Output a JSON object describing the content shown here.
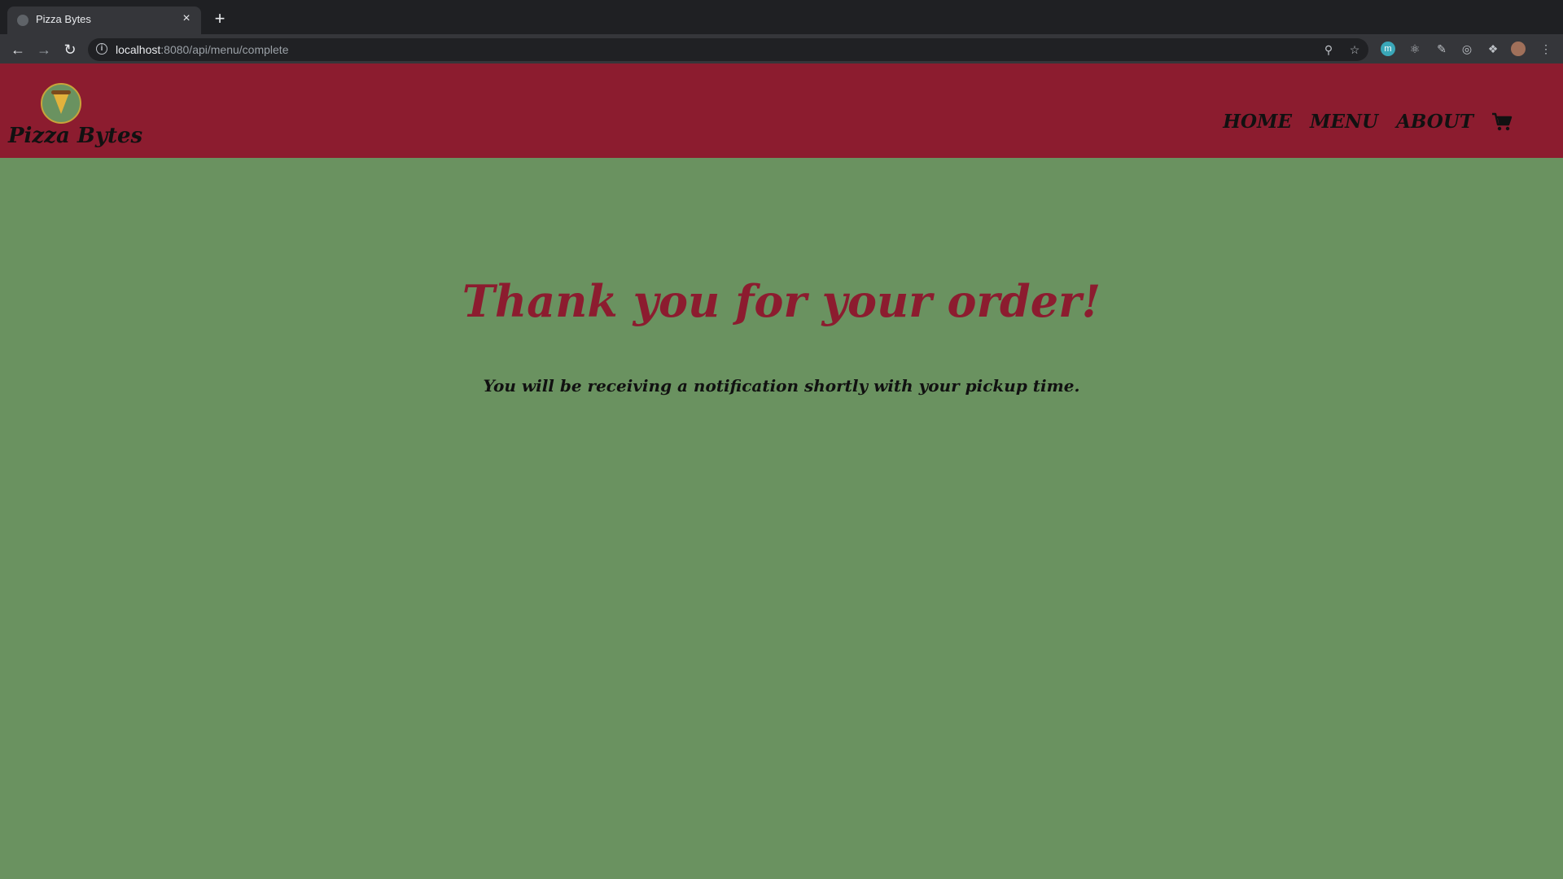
{
  "browser": {
    "tab": {
      "title": "Pizza Bytes",
      "close_glyph": "×"
    },
    "new_tab_glyph": "+",
    "url": {
      "host": "localhost",
      "path": ":8080/api/menu/complete"
    },
    "icons": [
      "back-icon",
      "forward-icon",
      "reload-icon",
      "info-icon",
      "zoom-icon",
      "bookmark-star-icon",
      "extension-m-icon",
      "extension-react-icon",
      "extension-pen-icon",
      "extension-target-icon",
      "extensions-puzzle-icon",
      "profile-avatar",
      "menu-kebab-icon"
    ]
  },
  "site": {
    "brand": "Pizza Bytes",
    "nav": [
      "HOME",
      "MENU",
      "ABOUT"
    ],
    "header_color": "#8c1c2f",
    "background_color": "#6a9260"
  },
  "main": {
    "title": "Thank you for your order!",
    "message": "You will be receiving a notification shortly with your pickup time."
  }
}
